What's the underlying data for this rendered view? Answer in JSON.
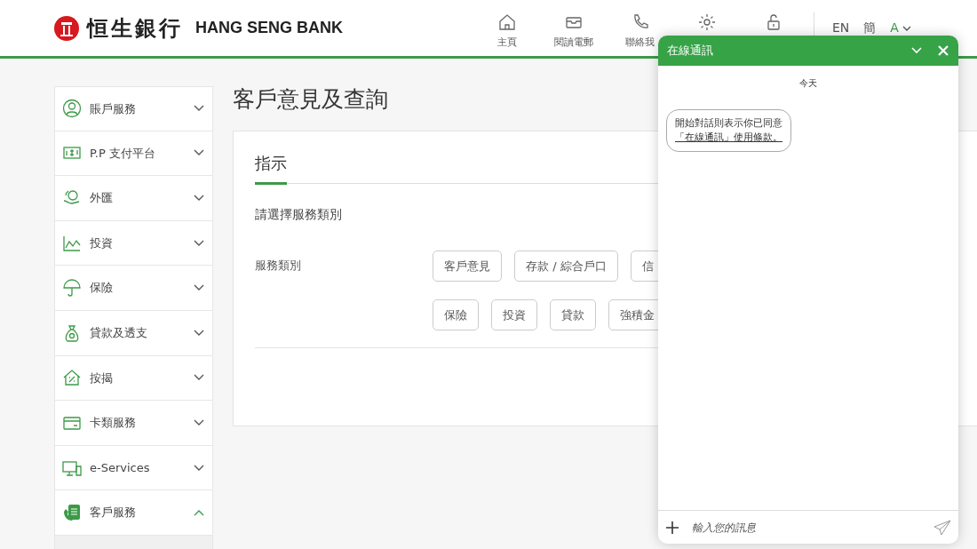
{
  "header": {
    "logo_zh": "恒生銀行",
    "logo_en": "HANG SENG BANK",
    "nav": [
      "主頁",
      "閱讀電郵",
      "聯絡我"
    ],
    "languages": [
      "EN",
      "簡"
    ],
    "font_size": "A"
  },
  "sidebar": {
    "items": [
      {
        "label": "賬戶服務",
        "expanded": false
      },
      {
        "label": "P.P 支付平台",
        "expanded": false
      },
      {
        "label": "外匯",
        "expanded": false
      },
      {
        "label": "投資",
        "expanded": false
      },
      {
        "label": "保險",
        "expanded": false
      },
      {
        "label": "貸款及透支",
        "expanded": false
      },
      {
        "label": "按揭",
        "expanded": false
      },
      {
        "label": "卡類服務",
        "expanded": false
      },
      {
        "label": "e-Services",
        "expanded": false
      },
      {
        "label": "客戶服務",
        "expanded": true
      }
    ]
  },
  "page_title": "客戶意見及查詢",
  "tabs": [
    {
      "label": "指示",
      "selected": true
    }
  ],
  "prompt": "請選擇服務類別",
  "field_label": "服務類別",
  "option_rows": [
    [
      "客戶意見",
      "存款 / 綜合戶口",
      "信"
    ],
    [
      "保險",
      "投資",
      "貸款",
      "強積金"
    ]
  ],
  "chat": {
    "title": "在線通訊",
    "date": "今天",
    "message": "開始對話則表示你已同意",
    "message_link": "「在線通訊」使用條款。",
    "placeholder": "輸入您的訊息"
  }
}
